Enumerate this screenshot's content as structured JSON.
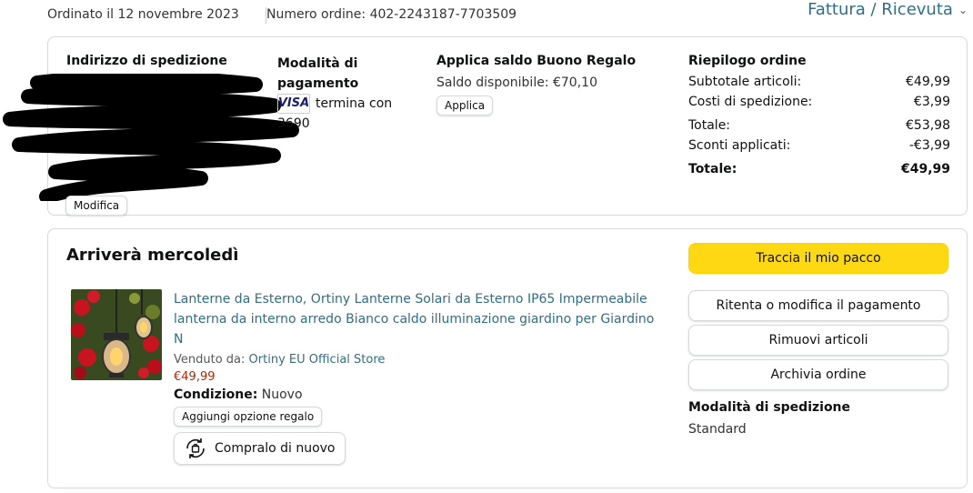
{
  "header": {
    "order_date": "Ordinato il 12 novembre 2023",
    "order_number": "Numero ordine: 402-2243187-7703509",
    "invoice_label": "Fattura / Ricevuta",
    "invoice_icon": "chevron-down-icon"
  },
  "shipping_address": {
    "heading": "Indirizzo di spedizione",
    "edit_label": "Modifica"
  },
  "payment": {
    "heading": "Modalità di pagamento",
    "card_brand": "VISA",
    "card_text": "termina con 3690"
  },
  "gift_card": {
    "heading": "Applica saldo Buono Regalo",
    "balance": "Saldo disponibile: €70,10",
    "apply_label": "Applica"
  },
  "summary": {
    "heading": "Riepilogo ordine",
    "rows": [
      {
        "label": "Subtotale articoli:",
        "value": "€49,99"
      },
      {
        "label": "Costi di spedizione:",
        "value": "€3,99"
      },
      {
        "label": "Totale:",
        "value": "€53,98"
      },
      {
        "label": "Sconti applicati:",
        "value": "-€3,99"
      }
    ],
    "grand_total_label": "Totale:",
    "grand_total_value": "€49,99"
  },
  "shipment": {
    "arrival": "Arriverà mercoledì",
    "product": {
      "title": "Lanterne da Esterno, Ortiny Lanterne Solari da Esterno IP65 Impermeabile lanterna da interno arredo Bianco caldo illuminazione giardino per Giardino N",
      "sold_by_label": "Venduto da:",
      "seller": "Ortiny EU Official Store",
      "price": "€49,99",
      "condition_label": "Condizione:",
      "condition_value": "Nuovo",
      "gift_option_label": "Aggiungi opzione regalo",
      "buy_again_label": "Compralo di nuovo"
    },
    "actions": {
      "track": "Traccia il mio pacco",
      "retry_payment": "Ritenta o modifica il pagamento",
      "remove_items": "Rimuovi articoli",
      "archive": "Archivia ordine"
    },
    "shipping_method_heading": "Modalità di spedizione",
    "shipping_method_value": "Standard"
  },
  "colors": {
    "link": "#2f6f88",
    "price": "#b12704",
    "primary_button": "#ffd814",
    "border": "#d5d9d9"
  }
}
